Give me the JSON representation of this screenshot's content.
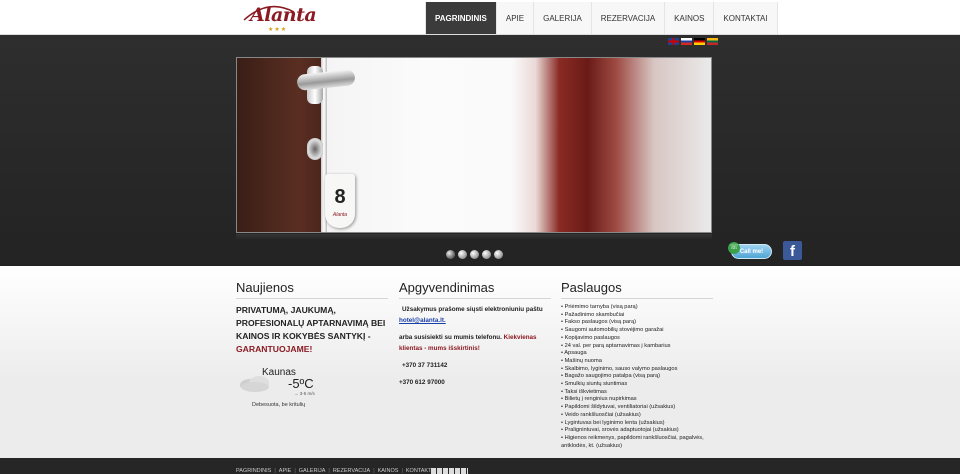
{
  "brand": {
    "logo_text": "Alanta",
    "logo_stars": "★★★"
  },
  "nav": {
    "items": [
      {
        "label": "PAGRINDINIS",
        "active": true
      },
      {
        "label": "APIE"
      },
      {
        "label": "GALERIJA"
      },
      {
        "label": "REZERVACIJA"
      },
      {
        "label": "KAINOS"
      },
      {
        "label": "KONTAKTAI"
      }
    ]
  },
  "languages": [
    "english-flag",
    "russian-flag",
    "german-flag",
    "lithuanian-flag"
  ],
  "hero": {
    "key_number": "8",
    "key_logo": "Alanta",
    "slides_count": 5,
    "active_slide": 1,
    "callme_label": "Call me!",
    "facebook_label": "f"
  },
  "news": {
    "title": "Naujienos",
    "text_main": "PRIVATUMĄ, JAUKUMĄ, PROFESIONALŲ APTARNAVIMĄ BEI KAINOS IR KOKYBĖS SANTYKĮ -",
    "text_red": "GARANTUOJAME!",
    "weather": {
      "city": "Kaunas",
      "temperature": "-5ºC",
      "wind": "→ 3-5 m/s",
      "condition": "Debesuota, be kritulių"
    }
  },
  "accommodation": {
    "title": "Apgyvendinimas",
    "line1": "Užsakymus prašome siųsti elektroniuniu paštu",
    "email": "hotel@alanta.lt.",
    "line2": "arba susisiekti su mumis telefonu.",
    "line2_red": "Kiekvienas klientas - mums išskirtinis!",
    "phone1": "+370 37 731142",
    "phone2": "+370 612 97000"
  },
  "services": {
    "title": "Paslaugos",
    "items": [
      "• Priėmimo tarnyba (visą parą)",
      "• Pažadinimo skambučiai",
      "• Fakso paslaugos (visą parą)",
      "• Saugomi automobilių stovėjimo garažai",
      "• Kopijavimo paslaugos",
      "• 24 val. per parą aptarnavimas į kambarius",
      "• Apsauga",
      "• Mašinų nuoma",
      "• Skalbimo, lyginimo, sauso valymo paslaugos",
      "• Bagažo saugojimo patalpa (visą parą)",
      "• Smulkių siuntų siuntimas",
      "• Taksi iškvietimas",
      "• Bilietų į renginius nupirkimas",
      "• Papildomi šildytuvai, ventiliatoriai (užsakius)",
      "• Veido rankšluosčiai (užsakius)",
      "• Lygintuvas bei lyginimo lenta (užsakius)",
      "• Pralignintuvai, srovės adaptuotojai (užsakius)",
      "• Higienos reikmenys, papildomi rankšluosčiai, pagalvės, antklodės, kt. (užsakius)"
    ]
  },
  "footer": {
    "links": [
      "PAGRINDINIS",
      "APIE",
      "GALERIJA",
      "REZERVACIJA",
      "KAINOS",
      "KONTAKTAI"
    ],
    "separator": "|"
  }
}
